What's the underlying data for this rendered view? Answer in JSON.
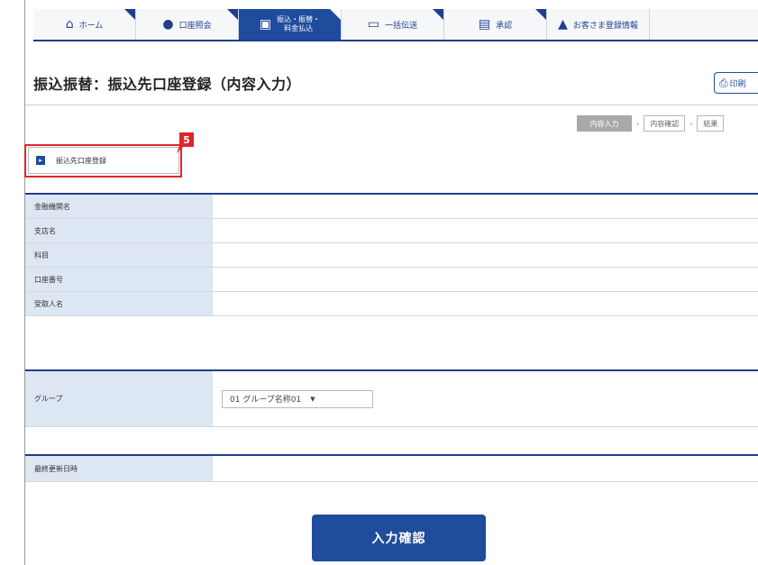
{
  "nav": {
    "items": [
      {
        "label": "ホーム",
        "icon": "home-icon",
        "glyph": "⌂"
      },
      {
        "label": "口座照会",
        "icon": "account-inquiry-icon",
        "glyph": "●"
      },
      {
        "label": "振込・振替・\n料金払込",
        "icon": "transfer-icon",
        "glyph": "▣"
      },
      {
        "label": "一括伝送",
        "icon": "batch-transmission-icon",
        "glyph": "▭"
      },
      {
        "label": "承認",
        "icon": "approval-icon",
        "glyph": "▤"
      },
      {
        "label": "お客さま登録情報",
        "icon": "customer-info-icon",
        "glyph": "▲"
      }
    ],
    "active_index": 2
  },
  "page": {
    "title": "振込振替：振込先口座登録（内容入力）",
    "print_label": "印刷"
  },
  "steps": [
    "内容入力",
    "内容確認",
    "結果"
  ],
  "register_button_label": "振込先口座登録",
  "callout_number": "5",
  "account_table": {
    "rows": [
      {
        "label": "金融機関名",
        "value": ""
      },
      {
        "label": "支店名",
        "value": ""
      },
      {
        "label": "科目",
        "value": ""
      },
      {
        "label": "口座番号",
        "value": ""
      },
      {
        "label": "受取人名",
        "value": ""
      }
    ]
  },
  "group": {
    "label": "グループ",
    "selected": "01 グループ名称01"
  },
  "last_updated": {
    "label": "最終更新日時",
    "value": ""
  },
  "confirm_button_label": "入力確認",
  "colors": {
    "primary": "#1f4c9c",
    "header_cell": "#dde6f3",
    "callout": "#e0252b"
  }
}
